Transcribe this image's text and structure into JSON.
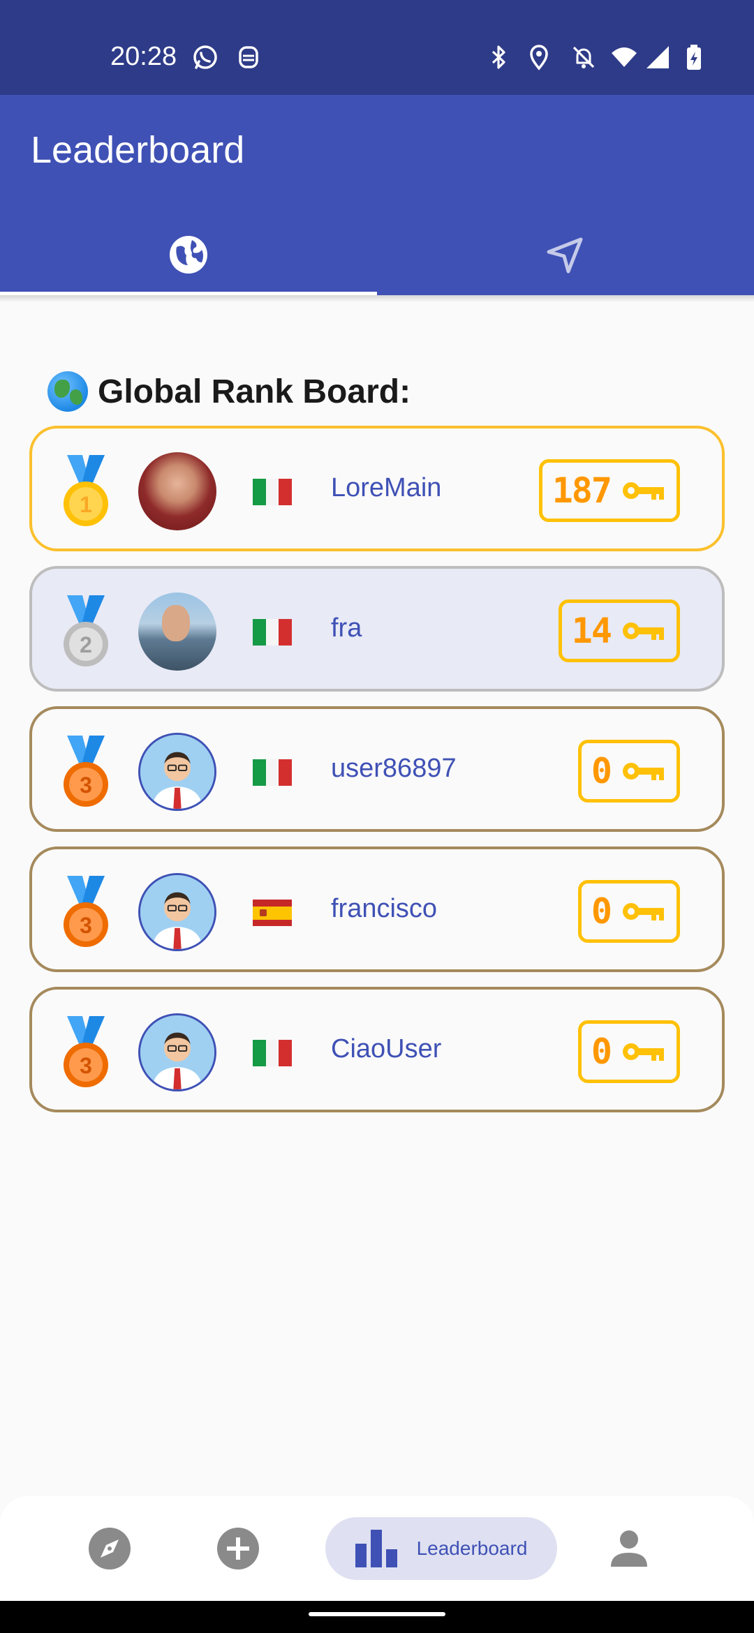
{
  "status_bar": {
    "time": "20:28",
    "left_icons": [
      "whatsapp-icon",
      "notification-app-icon"
    ],
    "right_icons": [
      "bluetooth-icon",
      "location-icon",
      "mute-icon",
      "wifi-icon",
      "signal-icon",
      "battery-charging-icon"
    ]
  },
  "app_bar": {
    "title": "Leaderboard",
    "tabs": [
      {
        "icon": "globe-icon",
        "selected": true
      },
      {
        "icon": "navigation-arrow-icon",
        "selected": false
      }
    ]
  },
  "section_title": "Global Rank Board:",
  "colors": {
    "primary": "#3f51b5",
    "status_bar": "#2e3b88",
    "gold": "#fbc02d",
    "silver": "#bdbdbd",
    "bronze": "#a58a5c",
    "score": "#ff9800"
  },
  "ranks": [
    {
      "rank": "1",
      "medal": "gold",
      "avatar": "photo",
      "country": "Italy",
      "username": "LoreMain",
      "score": "187"
    },
    {
      "rank": "2",
      "medal": "silver",
      "avatar": "photo",
      "country": "Italy",
      "username": "fra",
      "score": "14"
    },
    {
      "rank": "3",
      "medal": "bronze",
      "avatar": "cartoon",
      "country": "Italy",
      "username": "user86897",
      "score": "0"
    },
    {
      "rank": "3",
      "medal": "bronze",
      "avatar": "cartoon",
      "country": "Spain",
      "username": "francisco",
      "score": "0"
    },
    {
      "rank": "3",
      "medal": "bronze",
      "avatar": "cartoon",
      "country": "Italy",
      "username": "CiaoUser",
      "score": "0"
    }
  ],
  "bottom_nav": {
    "items": [
      {
        "icon": "compass-icon",
        "label": ""
      },
      {
        "icon": "add-circle-icon",
        "label": ""
      },
      {
        "icon": "leaderboard-icon",
        "label": "Leaderboard",
        "selected": true
      },
      {
        "icon": "person-icon",
        "label": ""
      }
    ]
  }
}
